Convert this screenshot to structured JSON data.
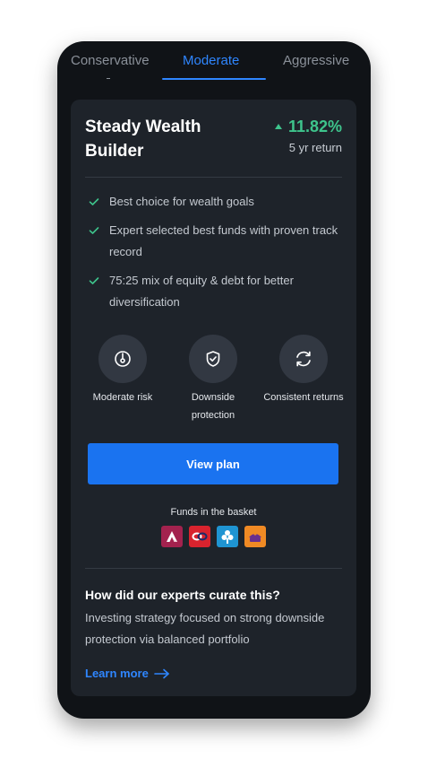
{
  "tabs": [
    {
      "label": "Conservative"
    },
    {
      "label": "Moderate"
    },
    {
      "label": "Aggressive"
    }
  ],
  "active_tab": "Moderate",
  "plan": {
    "title": "Steady Wealth Builder",
    "return_value": "11.82%",
    "return_label": "5 yr return",
    "features": [
      "Best choice for wealth goals",
      "Expert selected best funds with proven track record",
      "75:25 mix of equity & debt for better diversification"
    ],
    "traits": [
      {
        "label": "Moderate risk",
        "icon": "gauge-icon"
      },
      {
        "label": "Downside protection",
        "icon": "shield-check-icon"
      },
      {
        "label": "Consistent returns",
        "icon": "refresh-icon"
      }
    ],
    "view_button": "View plan",
    "funds_label": "Funds in the basket",
    "funds": [
      {
        "icon": "axis-logo",
        "color": "#a3224e"
      },
      {
        "icon": "icici-logo",
        "color": "#d9232e"
      },
      {
        "icon": "kotak-logo",
        "color": "#1f94d2"
      },
      {
        "icon": "mirae-logo",
        "color": "#f08a24"
      }
    ],
    "curate_title": "How did our experts curate this?",
    "curate_desc": "Investing strategy focused on strong downside protection via balanced portfolio",
    "learn_more": "Learn more"
  },
  "colors": {
    "accent": "#2f86ff",
    "positive": "#3ec48c",
    "background": "#101317",
    "card": "#1e232a"
  }
}
